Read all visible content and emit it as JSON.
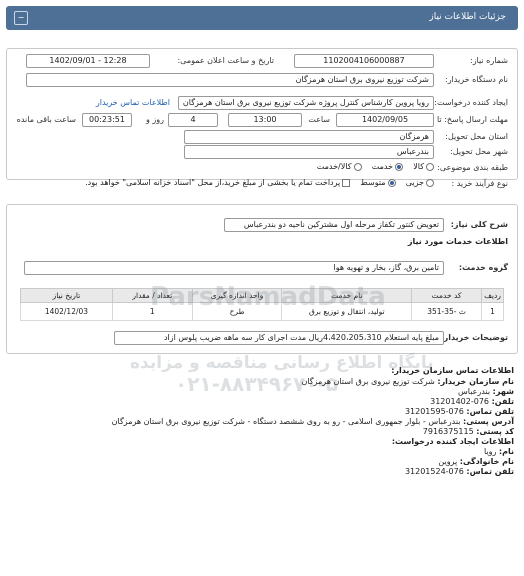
{
  "header": {
    "title": "جزئیات اطلاعات نیاز"
  },
  "details": {
    "need_number_label": "شماره نیاز:",
    "need_number": "1102004106000887",
    "announce_label": "تاریخ و ساعت اعلان عمومی:",
    "announce_value": "1402/09/01 - 12:28",
    "buyer_label": "نام دستگاه خریدار:",
    "buyer_value": "شرکت توزیع نیروی برق استان هرمزگان",
    "creator_label": "ایجاد کننده درخواست:",
    "creator_value": "رویا پروین کارشناس کنترل پروژه شرکت توزیع نیروی برق استان هرمزگان",
    "contact_link": "اطلاعات تماس خریدار",
    "deadline_label": "مهلت ارسال پاسخ: تا",
    "deadline_date": "1402/09/05",
    "time_label": "ساعت",
    "deadline_time": "13:00",
    "days_value": "4",
    "days_label": "روز و",
    "remaining_value": "00:23:51",
    "remaining_label": "ساعت باقی مانده",
    "province_label": "استان محل تحویل:",
    "province_value": "هرمزگان",
    "city_label": "شهر محل تحویل:",
    "city_value": "بندرعباس",
    "category_label": "طبقه بندی موضوعی:",
    "category_options": [
      "کالا",
      "خدمت",
      "کالا/خدمت"
    ],
    "category_selected": "خدمت",
    "process_label": "نوع فرآیند خرید :",
    "process_options": [
      "جزیی",
      "متوسط"
    ],
    "process_selected": "متوسط",
    "payment_note": "پرداخت تمام یا بخشی از مبلغ خرید،از محل \"اسناد خزانه اسلامی\" خواهد بود."
  },
  "description": {
    "label": "شرح کلی نیاز:",
    "value": "تعویض کنتور تکفاز مرحله اول مشترکین ناحیه دو بندرعباس"
  },
  "services": {
    "section_title": "اطلاعات خدمات مورد نیاز",
    "group_label": "گروه خدمت:",
    "group_value": "تامین برق، گاز، بخار و تهویه هوا",
    "table": {
      "headers": [
        "ردیف",
        "کد خدمت",
        "نام خدمت",
        "واحد اندازه گیری",
        "تعداد / مقدار",
        "تاریخ نیاز"
      ],
      "rows": [
        [
          "1",
          "ث -35-351",
          "تولید، انتقال و توزیع برق",
          "طرح",
          "1",
          "1402/12/03"
        ]
      ]
    },
    "notes_label": "توضیحات خریدار:",
    "notes_value": "مبلغ پایه استعلام 4،420،205،310ریال مدت اجرای کار سه ماهه ضریب پلوس ازاد"
  },
  "watermark": {
    "line1": "ParsNamadData",
    "line2": "پایگاه اطلاع رسانی مناقصه و مزایده",
    "phone": "۰۲۱-۸۸۳۴۹۶۷۰-۵"
  },
  "buyer_contact": {
    "title": "اطلاعات تماس سازمان خریدار:",
    "org_label": "نام سازمان خریدار:",
    "org_value": "شرکت توزیع نیروی برق استان هرمزگان",
    "city_label": "شهر:",
    "city_value": "بندرعباس",
    "phone_label": "تلفن:",
    "phone_value": "076-31201402",
    "fax_label": "تلفن تماس:",
    "fax_value": "076-31201595",
    "address_label": "آدرس پستی:",
    "address_value": "بندرعباس - بلوار جمهوری اسلامی - رو به روی ششصد دستگاه - شرکت توزیع نیروی برق استان هرمزگان",
    "postal_label": "کد پستی:",
    "postal_value": "7916375115"
  },
  "creator_contact": {
    "title": "اطلاعات ایجاد کننده درخواست:",
    "name_label": "نام:",
    "name_value": "رویا",
    "family_label": "نام خانوادگی:",
    "family_value": "پروین",
    "phone_label": "تلفن تماس:",
    "phone_value": "076-31201524"
  }
}
